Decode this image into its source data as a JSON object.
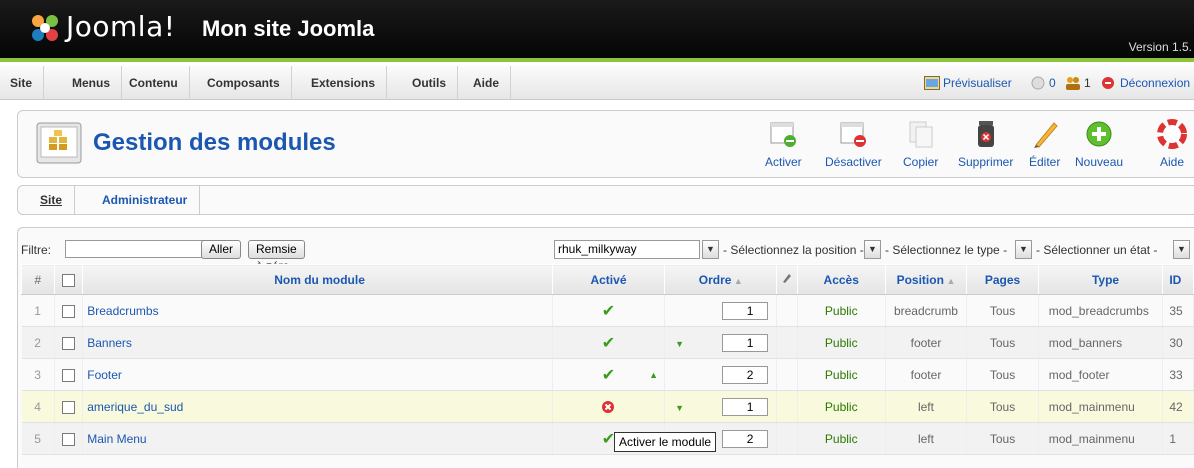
{
  "header": {
    "logo_text": "Joomla!",
    "site_title": "Mon site Joomla",
    "version": "Version 1.5."
  },
  "menu": {
    "items": [
      "Site",
      "Menus",
      "Contenu",
      "Composants",
      "Extensions",
      "Outils",
      "Aide"
    ],
    "preview": "Prévisualiser",
    "messages_count": "0",
    "users_count": "1",
    "logout": "Déconnexion"
  },
  "toolbar": {
    "title": "Gestion des modules",
    "buttons": [
      "Activer",
      "Désactiver",
      "Copier",
      "Supprimer",
      "Éditer",
      "Nouveau",
      "Aide"
    ]
  },
  "submenu": {
    "site": "Site",
    "admin": "Administrateur"
  },
  "filter": {
    "label": "Filtre:",
    "value": "",
    "go_button": "Aller",
    "reset_button": "Remsie à zéro",
    "template_select": "rhuk_milkyway",
    "position_select": "- Sélectionnez la position -",
    "type_select": "- Sélectionnez le type -",
    "state_select": "- Sélectionner un état -"
  },
  "table": {
    "headers": {
      "num": "#",
      "name": "Nom du module",
      "active": "Activé",
      "order": "Ordre",
      "access": "Accès",
      "position": "Position",
      "pages": "Pages",
      "type": "Type",
      "id": "ID"
    },
    "rows": [
      {
        "num": "1",
        "name": "Breadcrumbs",
        "active": true,
        "order": "1",
        "access": "Public",
        "position": "breadcrumb",
        "pages": "Tous",
        "type": "mod_breadcrumbs",
        "id": "35"
      },
      {
        "num": "2",
        "name": "Banners",
        "active": true,
        "order": "1",
        "access": "Public",
        "position": "footer",
        "pages": "Tous",
        "type": "mod_banners",
        "id": "30"
      },
      {
        "num": "3",
        "name": "Footer",
        "active": true,
        "order": "2",
        "access": "Public",
        "position": "footer",
        "pages": "Tous",
        "type": "mod_footer",
        "id": "33"
      },
      {
        "num": "4",
        "name": "amerique_du_sud",
        "active": false,
        "order": "1",
        "access": "Public",
        "position": "left",
        "pages": "Tous",
        "type": "mod_mainmenu",
        "id": "42"
      },
      {
        "num": "5",
        "name": "Main Menu",
        "active": true,
        "order": "2",
        "access": "Public",
        "position": "left",
        "pages": "Tous",
        "type": "mod_mainmenu",
        "id": "1"
      }
    ]
  },
  "tooltip": "Activer le module",
  "colors": {
    "brand_blue": "#1b57b1",
    "header_bg": "#111111",
    "accent_green": "#8cc63f",
    "highlight_row": "#f8f9dd"
  }
}
